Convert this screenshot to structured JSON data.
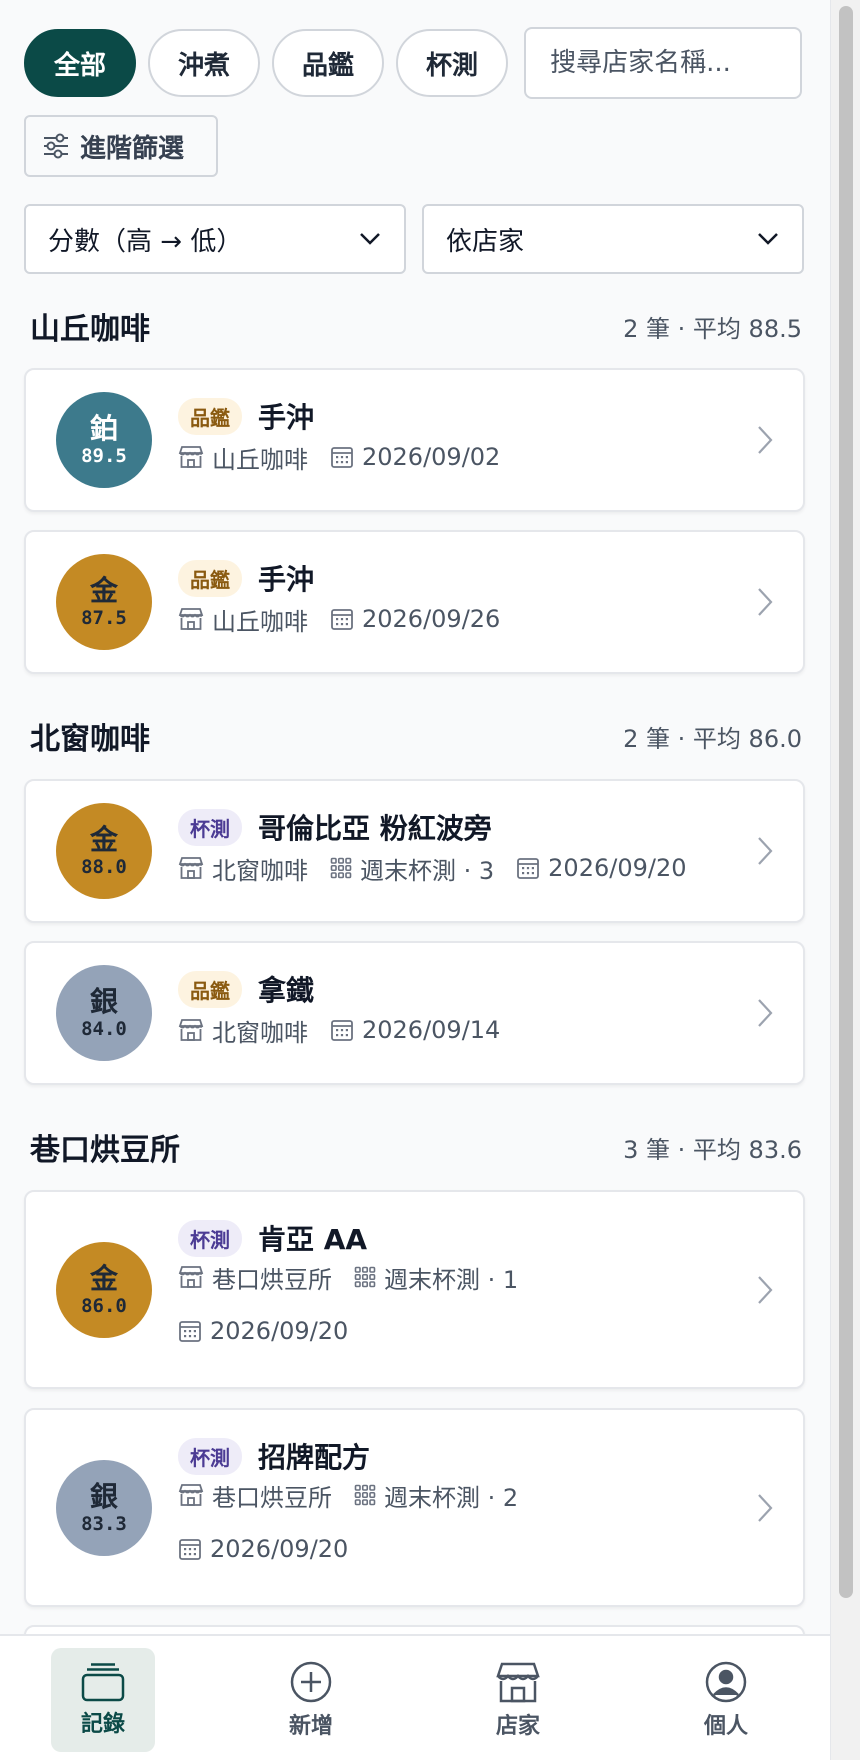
{
  "filters": {
    "chips": [
      {
        "label": "全部",
        "active": true
      },
      {
        "label": "沖煮",
        "active": false
      },
      {
        "label": "品鑑",
        "active": false
      },
      {
        "label": "杯測",
        "active": false
      }
    ],
    "search_placeholder": "搜尋店家名稱...",
    "advanced_label": "進階篩選",
    "sort_value": "分數（高 → 低）",
    "group_value": "依店家"
  },
  "groups": [
    {
      "name": "山丘咖啡",
      "meta": "2 筆 · 平均 88.5",
      "entries": [
        {
          "tier": "鉑",
          "score": "89.5",
          "tier_style": "plat",
          "tag": "品鑑",
          "tag_style": "pin",
          "title": "手沖",
          "shop": "山丘咖啡",
          "session": "",
          "date": "2026/09/02"
        },
        {
          "tier": "金",
          "score": "87.5",
          "tier_style": "gold",
          "tag": "品鑑",
          "tag_style": "pin",
          "title": "手沖",
          "shop": "山丘咖啡",
          "session": "",
          "date": "2026/09/26"
        }
      ]
    },
    {
      "name": "北窗咖啡",
      "meta": "2 筆 · 平均 86.0",
      "entries": [
        {
          "tier": "金",
          "score": "88.0",
          "tier_style": "gold",
          "tag": "杯測",
          "tag_style": "cup",
          "title": "哥倫比亞 粉紅波旁",
          "shop": "北窗咖啡",
          "session": "週末杯測 · 3",
          "date": "2026/09/20"
        },
        {
          "tier": "銀",
          "score": "84.0",
          "tier_style": "silver",
          "tag": "品鑑",
          "tag_style": "pin",
          "title": "拿鐵",
          "shop": "北窗咖啡",
          "session": "",
          "date": "2026/09/14"
        }
      ]
    },
    {
      "name": "巷口烘豆所",
      "meta": "3 筆 · 平均 83.6",
      "entries": [
        {
          "tier": "金",
          "score": "86.0",
          "tier_style": "gold",
          "tag": "杯測",
          "tag_style": "cup",
          "title": "肯亞 AA",
          "shop": "巷口烘豆所",
          "session": "週末杯測 · 1",
          "date": "2026/09/20"
        },
        {
          "tier": "銀",
          "score": "83.3",
          "tier_style": "silver",
          "tag": "杯測",
          "tag_style": "cup",
          "title": "招牌配方",
          "shop": "巷口烘豆所",
          "session": "週末杯測 · 2",
          "date": "2026/09/20"
        }
      ]
    }
  ],
  "nav": {
    "records": "記錄",
    "add": "新增",
    "shops": "店家",
    "profile": "個人"
  },
  "colors": {
    "accent": "#0b4a47",
    "platinum": "#3d7a8c",
    "gold": "#c48a24",
    "silver": "#94a3b8"
  }
}
